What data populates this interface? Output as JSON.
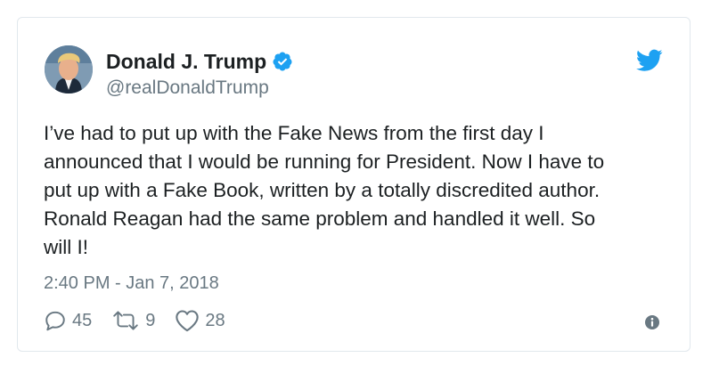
{
  "tweet": {
    "author": {
      "display_name": "Donald J. Trump",
      "handle": "@realDonaldTrump",
      "verified": true,
      "avatar_icon": "profile-photo"
    },
    "text": "I’ve had to put up with the Fake News from the first day I\nannounced that I would be running for President. Now I have to\nput up with a Fake Book, written by a totally discredited author.\nRonald Reagan had the same problem and handled it well. So\nwill I!",
    "timestamp": "2:40 PM - Jan 7, 2018",
    "stats": {
      "replies": "45",
      "retweets": "9",
      "likes": "28"
    },
    "icons": {
      "brand": "twitter-bird-icon",
      "verified": "verified-badge-icon",
      "reply": "reply-icon",
      "retweet": "retweet-icon",
      "like": "heart-icon",
      "info": "info-icon"
    }
  },
  "colors": {
    "twitter_blue": "#1da1f2",
    "text_primary": "#1c2022",
    "text_secondary": "#697882",
    "border": "#e1e8ed"
  }
}
